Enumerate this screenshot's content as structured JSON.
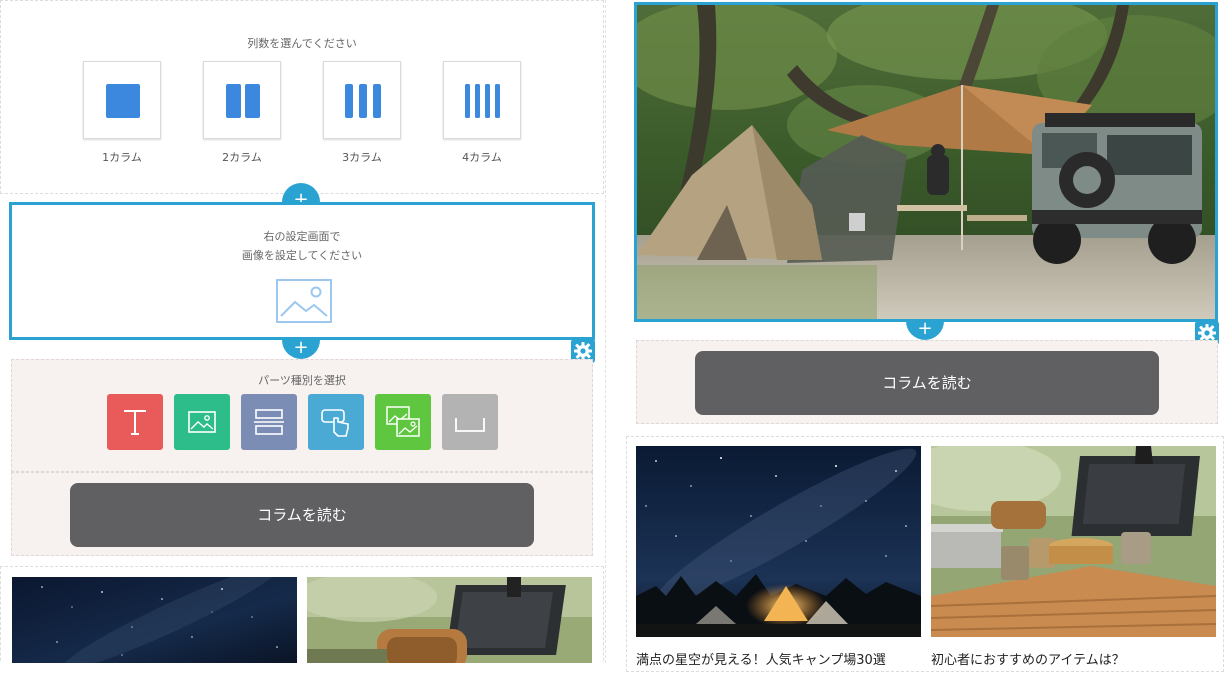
{
  "left_panel": {
    "column_picker": {
      "title": "列数を選んでください",
      "options": [
        {
          "label": "1カラム",
          "columns": 1
        },
        {
          "label": "2カラム",
          "columns": 2
        },
        {
          "label": "3カラム",
          "columns": 3
        },
        {
          "label": "4カラム",
          "columns": 4
        }
      ]
    },
    "add_label": "+",
    "image_placeholder": {
      "line1": "右の設定画面で",
      "line2": "画像を設定してください"
    },
    "parts_picker": {
      "title": "パーツ種別を選択",
      "parts": [
        {
          "icon": "text-icon",
          "color": "#e95b5b"
        },
        {
          "icon": "image-icon",
          "color": "#2dbd8b"
        },
        {
          "icon": "layout-icon",
          "color": "#7b8db5"
        },
        {
          "icon": "tap-icon",
          "color": "#4aaad4"
        },
        {
          "icon": "gallery-icon",
          "color": "#5ec73f"
        },
        {
          "icon": "spacer-icon",
          "color": "#b3b3b3"
        }
      ]
    },
    "read_button": "コラムを読む"
  },
  "right_panel": {
    "hero_image": {
      "icon": "camp-tent-photo"
    },
    "add_label": "+",
    "read_button": "コラムを読む",
    "articles": [
      {
        "caption": "満点の星空が見える！人気キャンプ場30選",
        "icon": "starry-camp-photo"
      },
      {
        "caption": "初心者におすすめのアイテムは？",
        "icon": "camp-gear-photo"
      }
    ]
  },
  "colors": {
    "accent": "#2aa3d3",
    "button_gray": "#606062",
    "parts_bg": "#f7f1ef",
    "column_icon": "#3d88df"
  }
}
